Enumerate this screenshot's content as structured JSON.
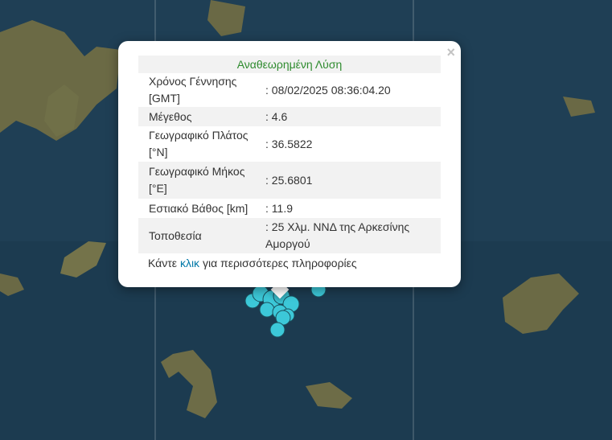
{
  "popup": {
    "title": "Αναθεωρημένη Λύση",
    "close_symbol": "×",
    "rows": [
      {
        "label": "Χρόνος Γέννησης [GMT]",
        "value": ": 08/02/2025 08:36:04.20"
      },
      {
        "label": "Μέγεθος",
        "value": ": 4.6"
      },
      {
        "label": "Γεωγραφικό Πλάτος [°N]",
        "value": ": 36.5822"
      },
      {
        "label": "Γεωγραφικό Μήκος [°E]",
        "value": ": 25.6801"
      },
      {
        "label": "Εστιακό Βάθος [km]",
        "value": ": 11.9"
      },
      {
        "label": "Τοποθεσία",
        "value": ": 25 Χλμ. ΝΝΔ της Αρκεσίνης Αμοργού"
      }
    ],
    "more_prefix": "Κάντε",
    "more_link": "κλικ",
    "more_suffix": "για περισσότερες πληροφορίες"
  },
  "map": {
    "sea_color": "#1f3f55",
    "land_color": "#6b6a45",
    "marker_fill": "#3cc8d8",
    "marker_stroke": "#1a4f5c",
    "grid_color": "#aeb8bf",
    "icons": [
      "earthquake-marker-icon",
      "close-icon"
    ]
  }
}
